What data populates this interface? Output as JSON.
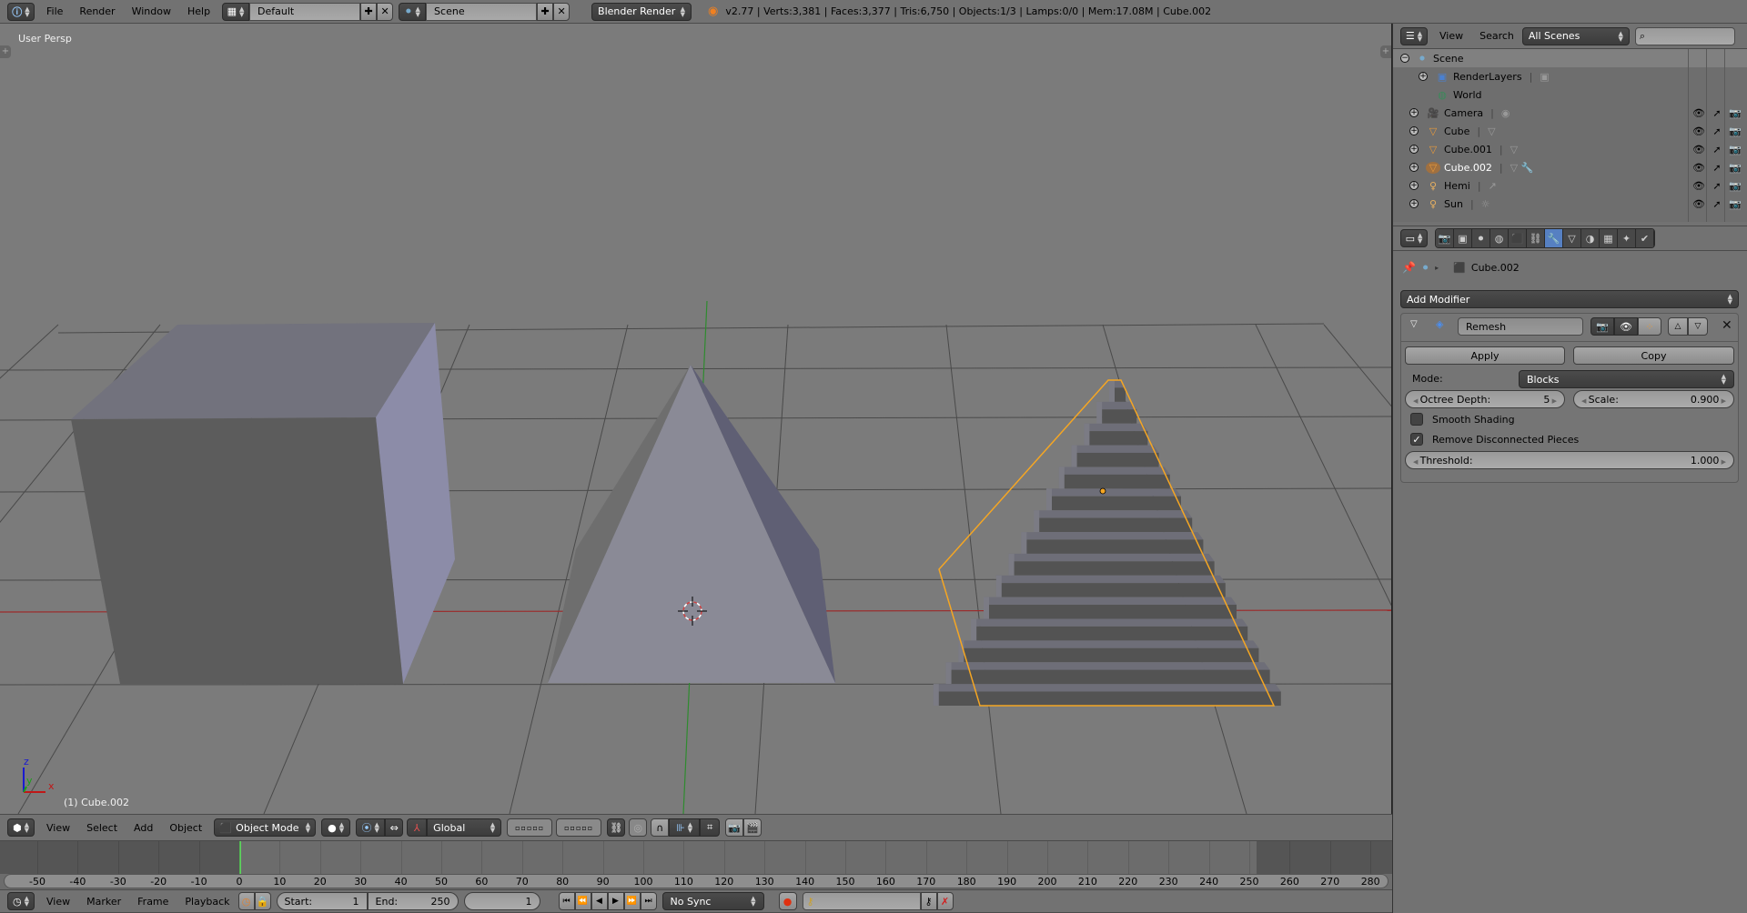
{
  "top_bar": {
    "info_icon": "info-icon",
    "menus": [
      "File",
      "Render",
      "Window",
      "Help"
    ],
    "screen_layout": "Default",
    "scene": "Scene",
    "render_engine": "Blender Render",
    "stats": "v2.77 | Verts:3,381 | Faces:3,377 | Tris:6,750 | Objects:1/3 | Lamps:0/0 | Mem:17.08M | Cube.002"
  },
  "viewport": {
    "view_label": "User Persp",
    "object_label": "(1) Cube.002",
    "axis": {
      "x": "x",
      "y": "y",
      "z": "z"
    },
    "colors": {
      "background": "#7b7b7b",
      "selection_outline": "#f5a623",
      "x_axis": "#9c2a2a",
      "y_axis": "#2f8b2f"
    }
  },
  "viewport_header": {
    "menus": [
      "View",
      "Select",
      "Add",
      "Object"
    ],
    "mode": "Object Mode",
    "orientation": "Global"
  },
  "timeline": {
    "ticks": [
      -50,
      -40,
      -30,
      -20,
      -10,
      0,
      10,
      20,
      30,
      40,
      50,
      60,
      70,
      80,
      90,
      100,
      110,
      120,
      130,
      140,
      150,
      160,
      170,
      180,
      190,
      200,
      210,
      220,
      230,
      240,
      250,
      260,
      270,
      280
    ],
    "current_frame": 1,
    "range_start": 1,
    "range_end": 250
  },
  "timeline_header": {
    "menus": [
      "View",
      "Marker",
      "Frame",
      "Playback"
    ],
    "start_label": "Start:",
    "start_value": "1",
    "end_label": "End:",
    "end_value": "250",
    "current_frame": "1",
    "sync": "No Sync"
  },
  "outliner": {
    "menus": [
      "View",
      "Search"
    ],
    "filter": "All Scenes",
    "search_placeholder": "",
    "items": [
      {
        "name": "Scene",
        "icon": "scene-icon"
      },
      {
        "name": "RenderLayers",
        "icon": "render-layers-icon"
      },
      {
        "name": "World",
        "icon": "world-icon"
      },
      {
        "name": "Camera",
        "icon": "camera-object-icon"
      },
      {
        "name": "Cube",
        "icon": "mesh-object-icon"
      },
      {
        "name": "Cube.001",
        "icon": "mesh-object-icon"
      },
      {
        "name": "Cube.002",
        "icon": "mesh-object-icon"
      },
      {
        "name": "Hemi",
        "icon": "lamp-icon"
      },
      {
        "name": "Sun",
        "icon": "lamp-icon"
      }
    ]
  },
  "properties": {
    "breadcrumb_object": "Cube.002",
    "add_modifier": "Add Modifier",
    "modifier": {
      "name": "Remesh",
      "apply": "Apply",
      "copy": "Copy",
      "mode_label": "Mode:",
      "mode_value": "Blocks",
      "octree_label": "Octree Depth:",
      "octree_value": "5",
      "scale_label": "Scale:",
      "scale_value": "0.900",
      "smooth_shading_label": "Smooth Shading",
      "smooth_shading": false,
      "remove_disconnected_label": "Remove Disconnected Pieces",
      "remove_disconnected": true,
      "threshold_label": "Threshold:",
      "threshold_value": "1.000"
    }
  }
}
